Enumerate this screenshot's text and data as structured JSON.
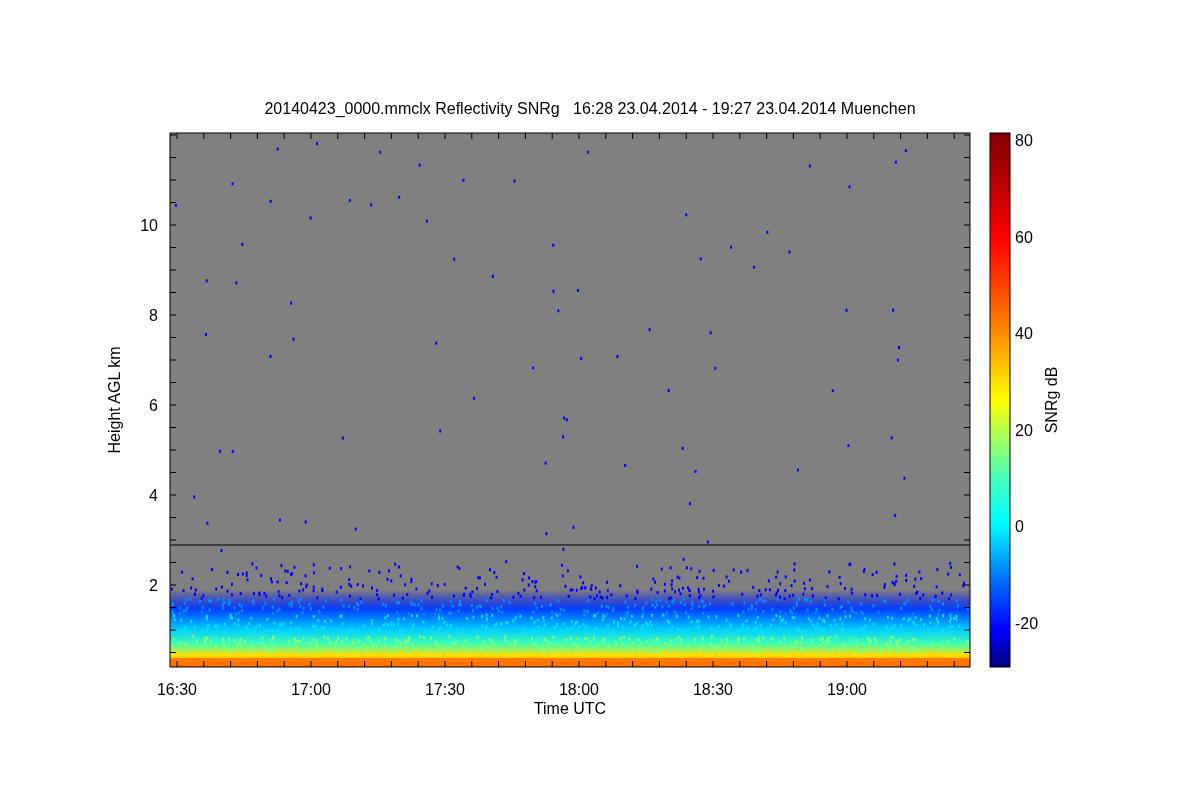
{
  "plot": {
    "title": "20140423_0000.mmclx Reflectivity SNRg   16:28 23.04.2014 - 19:27 23.04.2014 Muenchen",
    "ylabel": "Height AGL km",
    "xlabel": "Time UTC",
    "yticks": [
      "10",
      "8",
      "6",
      "4",
      "2"
    ],
    "xticks": [
      "16:30",
      "17:00",
      "17:30",
      "18:00",
      "18:30",
      "19:00"
    ]
  },
  "colorbar": {
    "label": "SNRg dB",
    "ticks": [
      "80",
      "60",
      "40",
      "20",
      "0",
      "-20"
    ]
  }
}
